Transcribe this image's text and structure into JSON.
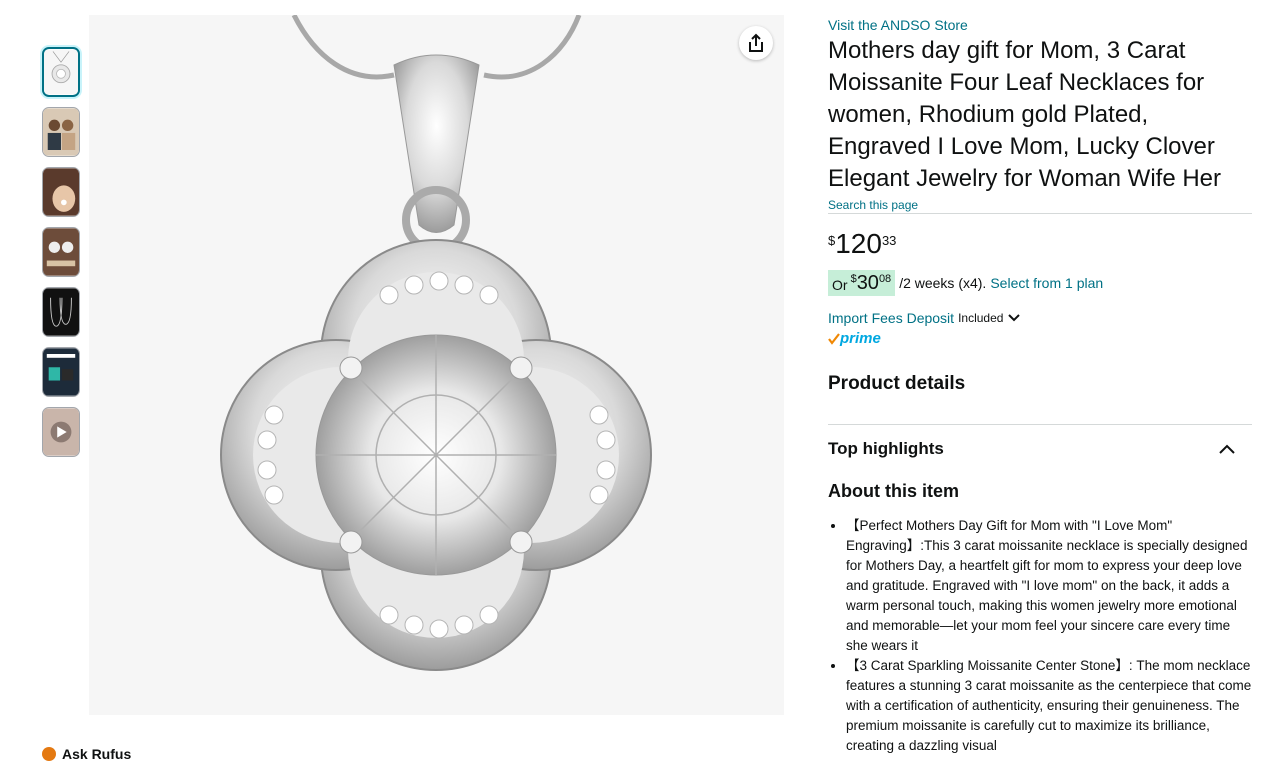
{
  "thumbnails": [
    {
      "alt": "necklace product thumbnail"
    },
    {
      "alt": "mother and daughter thumbnail"
    },
    {
      "alt": "necklace worn thumbnail"
    },
    {
      "alt": "product details thumbnail"
    },
    {
      "alt": "size chart thumbnail"
    },
    {
      "alt": "gift box thumbnail"
    },
    {
      "alt": "video thumbnail"
    }
  ],
  "ask_rufus": "Ask Rufus",
  "store_link": "Visit the ANDSO Store",
  "product_title": "Mothers day gift for Mom, 3 Carat Moissanite Four Leaf Necklaces for women, Rhodium gold Plated, Engraved I Love Mom, Lucky Clover Elegant Jewelry for Woman Wife Her",
  "search_page": "Search this page",
  "price": {
    "symbol": "$",
    "whole": "120",
    "fraction": "33"
  },
  "installment": {
    "or": "Or",
    "symbol": "$",
    "whole": "30",
    "fraction": "08",
    "period": "/2 weeks (x4).",
    "plan_link": "Select from 1 plan"
  },
  "import_fees": {
    "link": "Import Fees Deposit",
    "included": "Included"
  },
  "prime_label": "prime",
  "product_details_heading": "Product details",
  "top_highlights_heading": "Top highlights",
  "about_heading": "About this item",
  "bullets": [
    "【Perfect Mothers Day Gift for Mom with \"I Love Mom\" Engraving】:This 3 carat moissanite necklace is specially designed for Mothers Day, a heartfelt gift for mom to express your deep love and gratitude. Engraved with \"I love mom\" on the back, it adds a warm personal touch, making this women jewelry more emotional and memorable—let your mom feel your sincere care every time she wears it",
    "【3 Carat Sparkling Moissanite Center Stone】: The mom necklace features a stunning 3 carat moissanite as the centerpiece that come with a certification of authenticity, ensuring their genuineness. The premium moissanite is carefully cut to maximize its brilliance, creating a dazzling visual"
  ],
  "colors": {
    "link": "#007185",
    "badge": "#c6eed8",
    "prime": "#00a8e1",
    "accent": "#e47911"
  }
}
